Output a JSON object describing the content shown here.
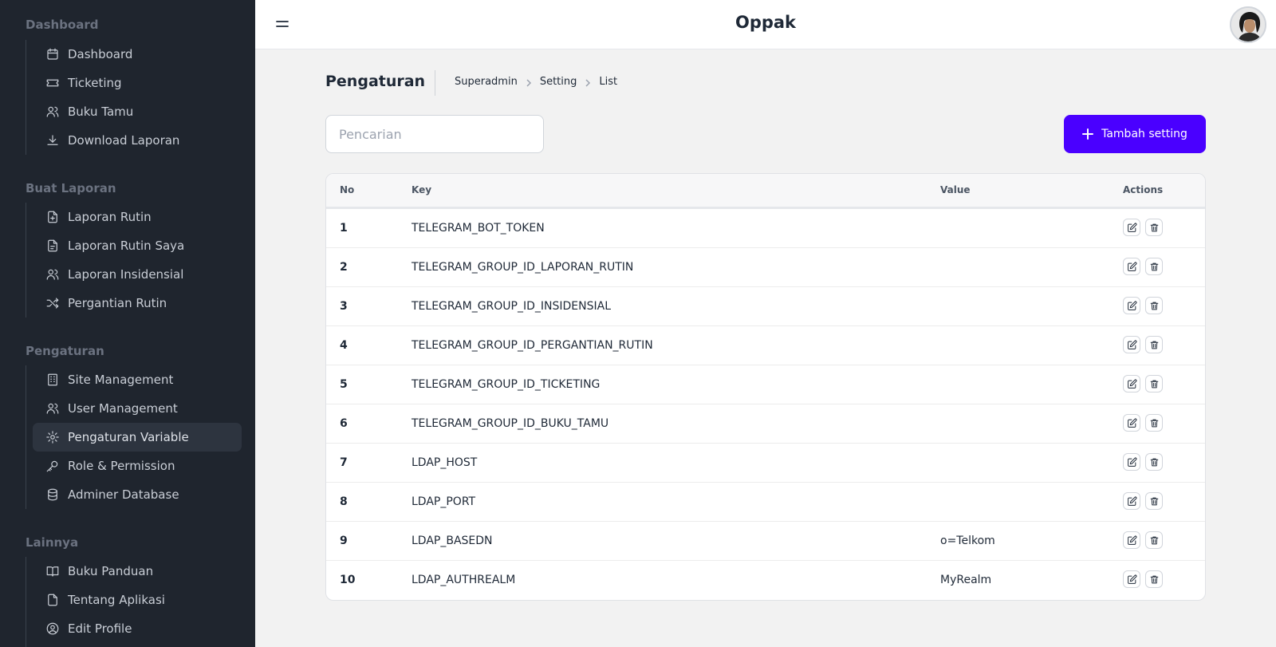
{
  "app": {
    "title": "Oppak"
  },
  "sidebar": {
    "sections": [
      {
        "title": "Dashboard",
        "items": [
          {
            "label": "Dashboard",
            "icon": "calendar-icon"
          },
          {
            "label": "Ticketing",
            "icon": "ticket-icon"
          },
          {
            "label": "Buku Tamu",
            "icon": "users-icon"
          },
          {
            "label": "Download Laporan",
            "icon": "download-icon"
          }
        ]
      },
      {
        "title": "Buat Laporan",
        "items": [
          {
            "label": "Laporan Rutin",
            "icon": "file-plus-icon"
          },
          {
            "label": "Laporan Rutin Saya",
            "icon": "file-text-icon"
          },
          {
            "label": "Laporan Insidensial",
            "icon": "users-icon"
          },
          {
            "label": "Pergantian Rutin",
            "icon": "shuffle-icon"
          }
        ]
      },
      {
        "title": "Pengaturan",
        "items": [
          {
            "label": "Site Management",
            "icon": "building-icon"
          },
          {
            "label": "User Management",
            "icon": "users-icon"
          },
          {
            "label": "Pengaturan Variable",
            "icon": "gear-icon",
            "active": true
          },
          {
            "label": "Role & Permission",
            "icon": "key-icon"
          },
          {
            "label": "Adminer Database",
            "icon": "database-icon"
          }
        ]
      },
      {
        "title": "Lainnya",
        "items": [
          {
            "label": "Buku Panduan",
            "icon": "book-icon"
          },
          {
            "label": "Tentang Aplikasi",
            "icon": "file-icon"
          },
          {
            "label": "Edit Profile",
            "icon": "user-circle-icon"
          }
        ]
      }
    ]
  },
  "page": {
    "title": "Pengaturan",
    "breadcrumb": [
      "Superadmin",
      "Setting",
      "List"
    ]
  },
  "search": {
    "placeholder": "Pencarian",
    "value": ""
  },
  "toolbar": {
    "add_label": "Tambah setting",
    "accent": "#4a00ff"
  },
  "table": {
    "columns": {
      "no": "No",
      "key": "Key",
      "value": "Value",
      "actions": "Actions"
    },
    "rows": [
      {
        "no": "1",
        "key": "TELEGRAM_BOT_TOKEN",
        "value": ""
      },
      {
        "no": "2",
        "key": "TELEGRAM_GROUP_ID_LAPORAN_RUTIN",
        "value": ""
      },
      {
        "no": "3",
        "key": "TELEGRAM_GROUP_ID_INSIDENSIAL",
        "value": ""
      },
      {
        "no": "4",
        "key": "TELEGRAM_GROUP_ID_PERGANTIAN_RUTIN",
        "value": ""
      },
      {
        "no": "5",
        "key": "TELEGRAM_GROUP_ID_TICKETING",
        "value": ""
      },
      {
        "no": "6",
        "key": "TELEGRAM_GROUP_ID_BUKU_TAMU",
        "value": ""
      },
      {
        "no": "7",
        "key": "LDAP_HOST",
        "value": ""
      },
      {
        "no": "8",
        "key": "LDAP_PORT",
        "value": ""
      },
      {
        "no": "9",
        "key": "LDAP_BASEDN",
        "value": "o=Telkom"
      },
      {
        "no": "10",
        "key": "LDAP_AUTHREALM",
        "value": "MyRealm"
      }
    ]
  }
}
